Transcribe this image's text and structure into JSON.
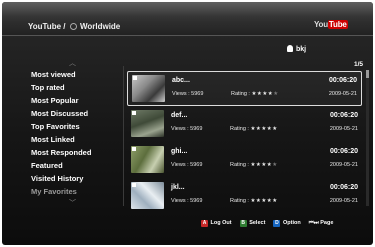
{
  "header": {
    "crumb_root": "YouTube /",
    "crumb_leaf": "Worldwide",
    "logo_you": "You",
    "logo_tube": "Tube"
  },
  "user": {
    "name": "bkj"
  },
  "pagination": {
    "indicator": "1/5"
  },
  "menu": {
    "items": [
      {
        "label": "Most viewed"
      },
      {
        "label": "Top rated"
      },
      {
        "label": "Most Popular"
      },
      {
        "label": "Most Discussed"
      },
      {
        "label": "Top Favorites"
      },
      {
        "label": "Most Linked"
      },
      {
        "label": "Most Responded"
      },
      {
        "label": "Featured"
      },
      {
        "label": "Visited History"
      },
      {
        "label": "My Favorites"
      }
    ]
  },
  "videos": [
    {
      "title": "abc...",
      "duration": "00:06:20",
      "views": "Views : 5969",
      "rating_label": "Rating :",
      "stars": "★★★★",
      "empty_stars": "★",
      "date": "2009-05-21",
      "selected": true
    },
    {
      "title": "def...",
      "duration": "00:06:20",
      "views": "Views : 5969",
      "rating_label": "Rating :",
      "stars": "★★★★★",
      "empty_stars": "",
      "date": "2009-05-21",
      "selected": false
    },
    {
      "title": "ghi...",
      "duration": "00:06:20",
      "views": "Views : 5969",
      "rating_label": "Rating :",
      "stars": "★★★★",
      "empty_stars": "★",
      "date": "2009-05-21",
      "selected": false
    },
    {
      "title": "jkl...",
      "duration": "00:06:20",
      "views": "Views : 5969",
      "rating_label": "Rating :",
      "stars": "★★★★★",
      "empty_stars": "",
      "date": "2009-05-21",
      "selected": false
    }
  ],
  "footer": {
    "a_key": "A",
    "a_label": "Log Out",
    "b_key": "B",
    "b_label": "Select",
    "d_key": "D",
    "d_label": "Option",
    "page_icon": "⏮⏭",
    "page_label": "Page"
  },
  "colors": {
    "key_a": "#c62828",
    "key_b": "#2e7d32",
    "key_d": "#1565c0",
    "logo_tube_bg": "#cc0000"
  }
}
